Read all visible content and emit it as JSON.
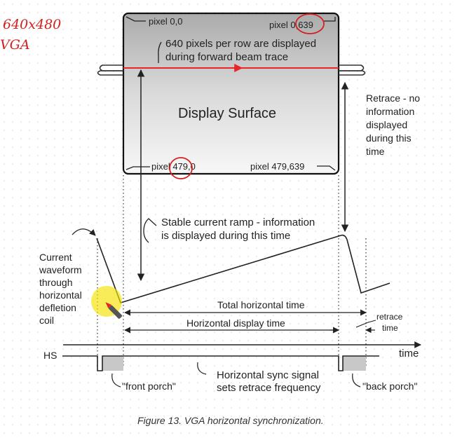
{
  "annotations": {
    "handwritten_resolution": "640x480",
    "handwritten_mode": "VGA"
  },
  "display": {
    "title": "Display Surface",
    "pixel_top_left": "pixel 0,0",
    "pixel_top_right": "pixel 0,639",
    "pixel_bottom_left": "pixel 479,0",
    "pixel_bottom_right": "pixel 479,639",
    "row_note_line1": "640 pixels per row are displayed",
    "row_note_line2": "during forward beam trace"
  },
  "retrace_note": [
    "Retrace - no",
    "information",
    "displayed",
    "during this",
    "time"
  ],
  "ramp_note": [
    "Stable current ramp - information",
    "is displayed during this time"
  ],
  "waveform_label": [
    "Current",
    "waveform",
    "through",
    "horizontal",
    "defletion",
    "coil"
  ],
  "timing": {
    "total_horizontal": "Total horizontal time",
    "horizontal_display": "Horizontal display time",
    "retrace_time_line1": "retrace",
    "retrace_time_line2": "time",
    "time_axis": "time"
  },
  "sync": {
    "hs_label": "HS",
    "sync_note_line1": "Horizontal sync signal",
    "sync_note_line2": "sets retrace frequency",
    "front_porch": "\"front porch\"",
    "back_porch": "\"back porch\""
  },
  "caption": "Figure 13. VGA horizontal synchronization.",
  "colors": {
    "beam": "#e8262a",
    "ink": "#d42020",
    "highlight": "#f5e300",
    "porch_fill": "#c8c8c8"
  }
}
